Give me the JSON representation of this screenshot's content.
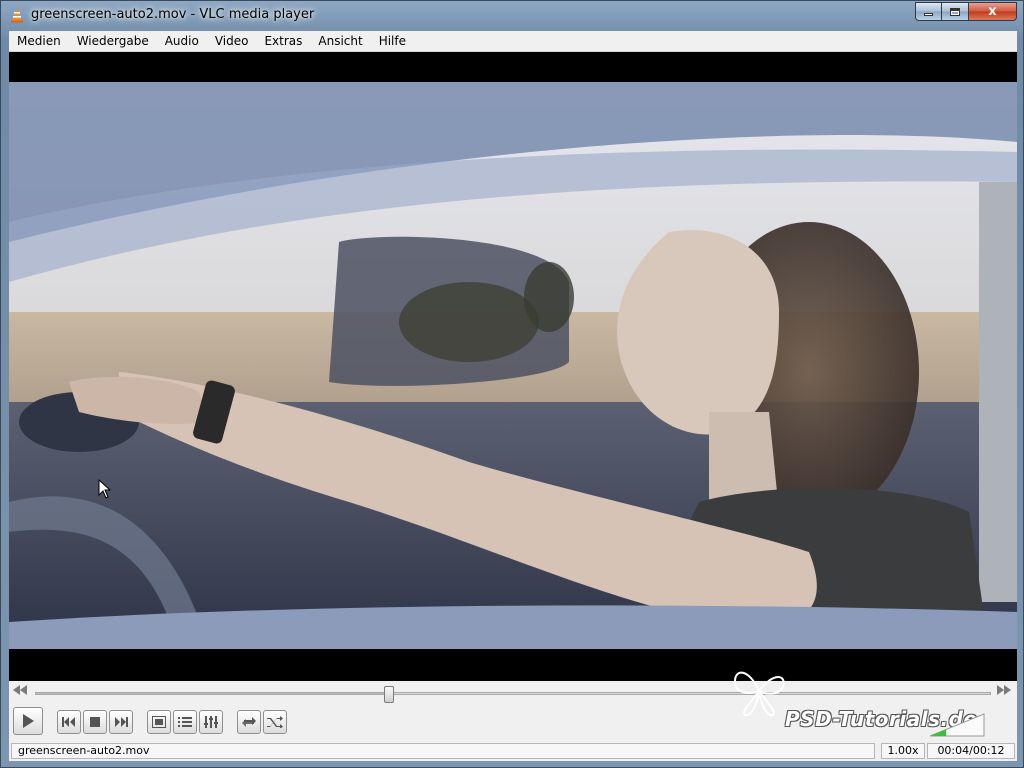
{
  "window": {
    "title": "greenscreen-auto2.mov - VLC media player",
    "controls": {
      "minimize": "",
      "maximize": "",
      "close": "x"
    }
  },
  "menu": [
    {
      "label": "Medien"
    },
    {
      "label": "Wiedergabe"
    },
    {
      "label": "Audio"
    },
    {
      "label": "Video"
    },
    {
      "label": "Extras"
    },
    {
      "label": "Ansicht"
    },
    {
      "label": "Hilfe"
    }
  ],
  "playback": {
    "position_fraction": 0.37,
    "volume_fraction": 0.3,
    "buttons": [
      "play-icon",
      "previous-icon",
      "stop-icon",
      "next-icon",
      "fullscreen-icon",
      "playlist-icon",
      "extended-settings-icon",
      "loop-icon",
      "shuffle-icon"
    ]
  },
  "watermark": {
    "text": "PSD-Tutorials.de"
  },
  "status": {
    "file": "greenscreen-auto2.mov",
    "speed": "1.00x",
    "time": "00:04/00:12"
  },
  "colors": {
    "accent_orange": "#f08a24",
    "volume_green": "#3cbf3c"
  }
}
